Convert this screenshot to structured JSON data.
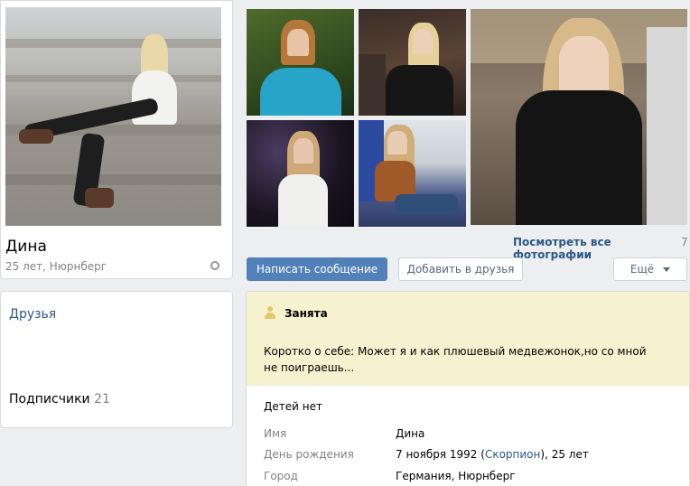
{
  "profile": {
    "name": "Дина",
    "meta": "25 лет, Нюрнберг"
  },
  "sidebar": {
    "friends_title": "Друзья",
    "subscribers_label": "Подписчики",
    "subscribers_count": "21"
  },
  "photos": {
    "all_label": "Посмотреть все фотографии",
    "count": "7"
  },
  "actions": {
    "message": "Написать сообщение",
    "add_friend": "Добавить в друзья",
    "more": "Ещё"
  },
  "info": {
    "status": "Занята",
    "about": "Коротко о себе: Может я и как плюшевый медвежонок,но со мной не поиграешь...",
    "children": "Детей нет",
    "rows": {
      "name": {
        "label": "Имя",
        "value": "Дина"
      },
      "birthday": {
        "label": "День рождения",
        "date": "7 ноября 1992",
        "sign": "Скорпион",
        "age": "25 лет"
      },
      "city": {
        "label": "Город",
        "value": "Германия, Нюрнберг"
      }
    }
  },
  "colors": {
    "link": "#2a5885",
    "primary_button": "#5181b8",
    "status_bg": "#f6f1cf",
    "page_bg": "#edeef0"
  }
}
